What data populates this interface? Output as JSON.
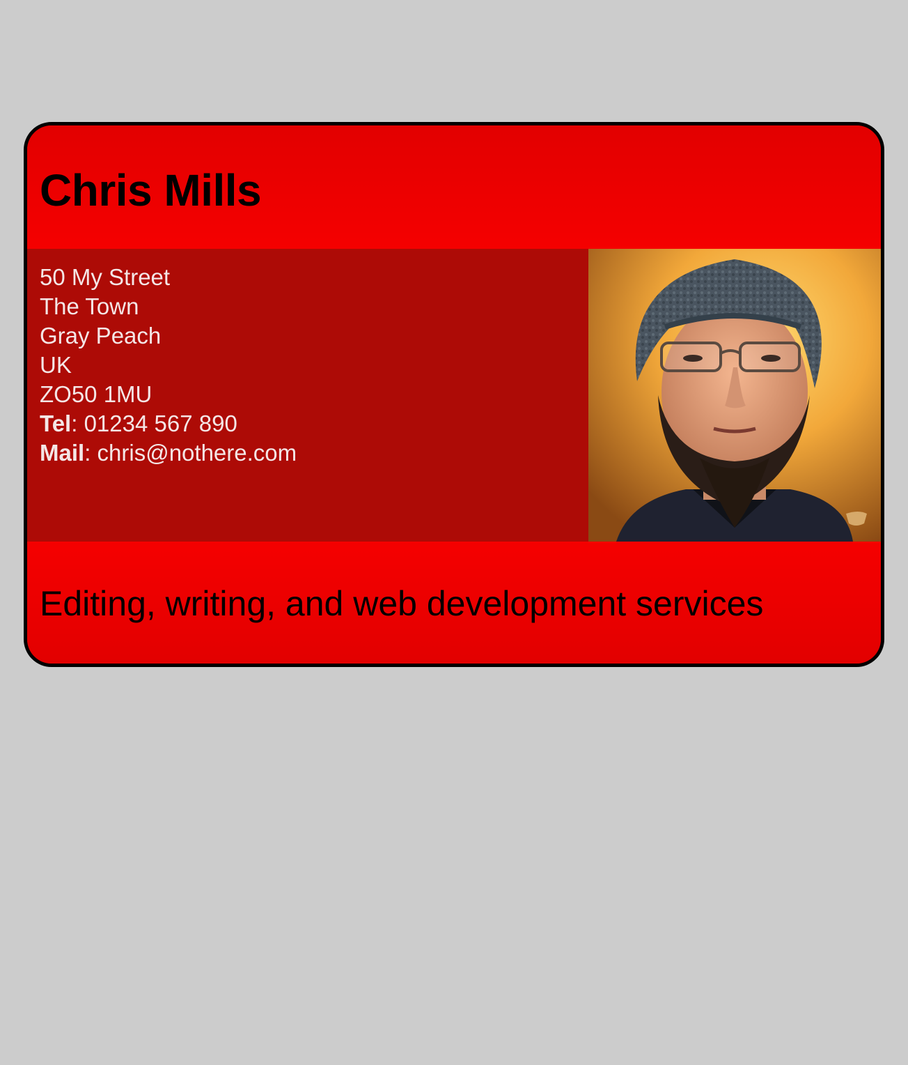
{
  "card": {
    "name": "Chris Mills",
    "address_lines": [
      "50 My Street",
      "The Town",
      "Gray Peach",
      "UK",
      "ZO50 1MU"
    ],
    "tel_label": "Tel",
    "tel_value": "01234 567 890",
    "mail_label": "Mail",
    "mail_value": "chris@nothere.com",
    "tagline": "Editing, writing, and web development services"
  },
  "colors": {
    "page_background": "#cccccc",
    "header_footer_red": "#f00000",
    "body_dark_red": "#ad0b06",
    "border": "#000000",
    "address_text": "#f4e6e6"
  }
}
